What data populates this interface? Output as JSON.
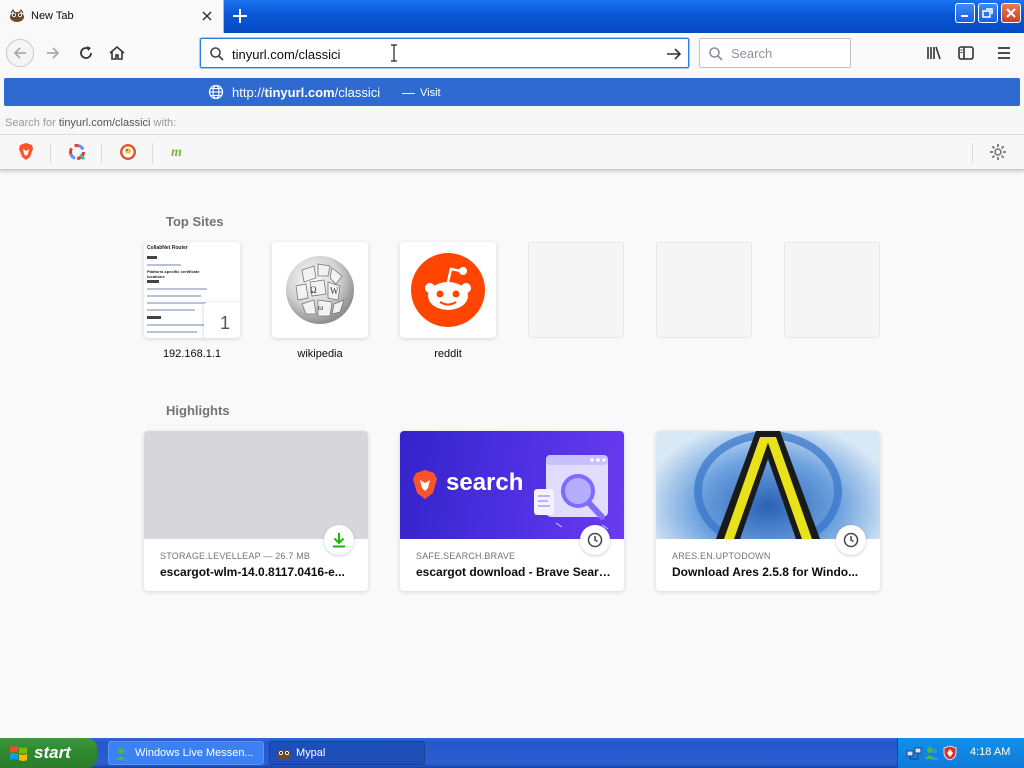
{
  "browser": {
    "tab": {
      "title": "New Tab",
      "favicon": "mypal-favicon"
    },
    "url_value": "tinyurl.com/classici",
    "search_placeholder": "Search"
  },
  "autocomplete": {
    "prefix": "http://",
    "domain": "tinyurl.com",
    "path": "/classici",
    "separator": "—",
    "action": "Visit",
    "search_with_prefix": "Search for ",
    "search_with_query": "tinyurl.com/classici",
    "search_with_suffix": " with:",
    "engines": [
      "brave-icon",
      "qwant-icon",
      "duckduckgo-icon",
      "mojeek-icon"
    ]
  },
  "newtab": {
    "top_sites_title": "Top Sites",
    "top_sites": [
      {
        "label": "192.168.1.1",
        "pin": "1"
      },
      {
        "label": "wikipedia"
      },
      {
        "label": "reddit"
      }
    ],
    "thumb": {
      "title": "CollabNet Router",
      "subtitle": "Platform-specific certificate locations"
    },
    "highlights_title": "Highlights",
    "highlights": [
      {
        "context": "STORAGE.LEVELLEAP — 26.7 MB",
        "title": "escargot-wlm-14.0.8117.0416-e...",
        "badge": "download-icon"
      },
      {
        "context": "SAFE.SEARCH.BRAVE",
        "title": "escargot download - Brave Search",
        "badge": "clock-icon",
        "image_text": "search"
      },
      {
        "context": "ARES.EN.UPTODOWN",
        "title": "Download Ares 2.5.8 for Windo...",
        "badge": "clock-icon"
      }
    ]
  },
  "taskbar": {
    "start_label": "start",
    "tasks": [
      {
        "label": "Windows Live Messen...",
        "icon": "messenger-icon"
      },
      {
        "label": "Mypal",
        "icon": "mypal-icon"
      }
    ],
    "clock": "4:18 AM"
  },
  "colors": {
    "accent": "#2f6ad0",
    "reddit": "#ff4500",
    "brave_search_bg": "#3e2bd4"
  }
}
